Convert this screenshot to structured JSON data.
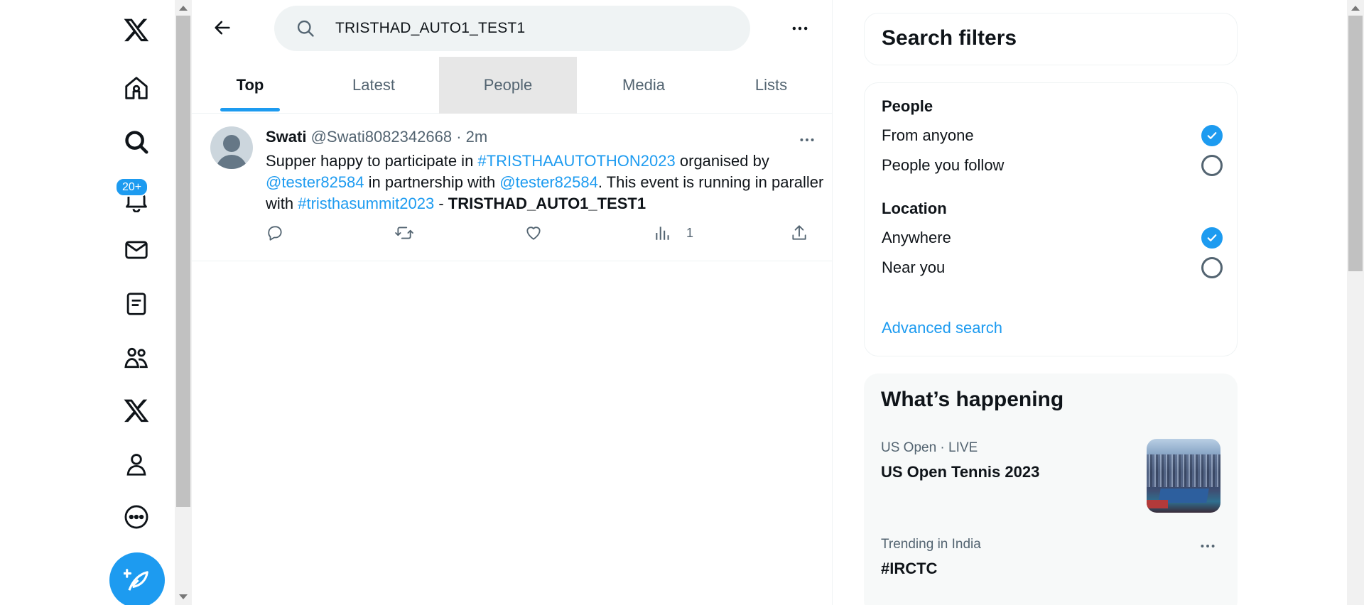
{
  "search": {
    "query": "TRISTHAD_AUTO1_TEST1"
  },
  "nav": {
    "notifications_badge": "20+"
  },
  "tabs": [
    {
      "label": "Top",
      "active": true
    },
    {
      "label": "Latest",
      "active": false
    },
    {
      "label": "People",
      "active": false
    },
    {
      "label": "Media",
      "active": false
    },
    {
      "label": "Lists",
      "active": false
    }
  ],
  "tweet": {
    "name": "Swati",
    "handle": "@Swati8082342668",
    "separator": "·",
    "time": "2m",
    "text_1": "Supper happy to participate in ",
    "hashtag_1": "#TRISTHAAUTOTHON2023",
    "text_2": " organised by ",
    "mention_1": "@tester82584",
    "text_3": " in partnership with ",
    "mention_2": "@tester82584",
    "text_4": ". This event is running in paraller with ",
    "hashtag_2": "#tristhasummit2023",
    "text_5": " - ",
    "bold_text": "TRISTHAD_AUTO1_TEST1",
    "views": "1"
  },
  "filters": {
    "title": "Search filters",
    "people_heading": "People",
    "people_options": [
      {
        "label": "From anyone",
        "checked": true
      },
      {
        "label": "People you follow",
        "checked": false
      }
    ],
    "location_heading": "Location",
    "location_options": [
      {
        "label": "Anywhere",
        "checked": true
      },
      {
        "label": "Near you",
        "checked": false
      }
    ],
    "advanced": "Advanced search"
  },
  "happening": {
    "title": "What’s happening",
    "trends": [
      {
        "meta": "US Open · LIVE",
        "title": "US Open Tennis 2023"
      },
      {
        "meta": "Trending in India",
        "title": "#IRCTC"
      }
    ]
  },
  "colors": {
    "accent": "#1d9bf0",
    "text": "#0f1419",
    "muted": "#536471"
  }
}
